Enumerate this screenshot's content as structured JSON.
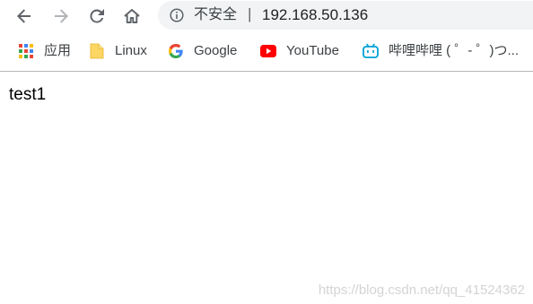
{
  "toolbar": {
    "back_icon": "arrow-left-icon",
    "forward_icon": "arrow-right-icon",
    "reload_icon": "reload-icon",
    "home_icon": "home-icon"
  },
  "omnibox": {
    "security_icon": "info-icon",
    "security_label": "不安全",
    "separator": "|",
    "url": "192.168.50.136"
  },
  "bookmarks": [
    {
      "label": "应用",
      "icon": "apps-grid-icon"
    },
    {
      "label": "Linux",
      "icon": "folder-icon"
    },
    {
      "label": "Google",
      "icon": "google-icon"
    },
    {
      "label": "YouTube",
      "icon": "youtube-icon"
    },
    {
      "label": "哔哩哔哩 ( ゜- ゜)つ...",
      "icon": "bilibili-icon"
    }
  ],
  "page": {
    "text": "test1"
  },
  "watermark": "https://blog.csdn.net/qq_41524362",
  "colors": {
    "omnibox_bg": "#f1f3f4",
    "divider": "#b8b8b8",
    "folder": "#fdd663",
    "youtube_red": "#ff0000",
    "bilibili_blue": "#00a1d6"
  }
}
